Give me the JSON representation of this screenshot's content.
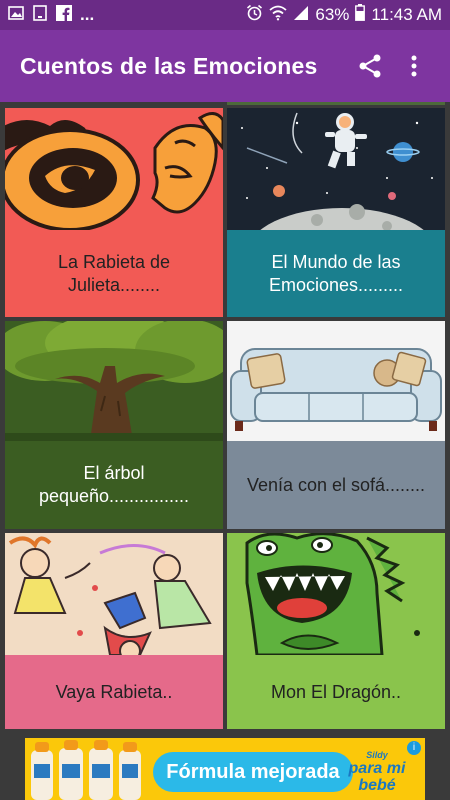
{
  "status_bar": {
    "left_icons": [
      "image-icon",
      "tablet-icon",
      "facebook-icon",
      "more-icon"
    ],
    "more_label": "...",
    "battery": "63%",
    "time": "11:43 AM"
  },
  "app_bar": {
    "title": "Cuentos de las Emociones",
    "share_icon": "share-icon",
    "menu_icon": "overflow-menu-icon"
  },
  "stories": [
    {
      "title": "La Rabieta de Julieta........",
      "image": "angry-faces",
      "caption_bg": "#f25a55"
    },
    {
      "title": "El Mundo de las Emociones.........",
      "image": "astronaut-space",
      "caption_bg": "#1a7f8e"
    },
    {
      "title": "El árbol pequeño................",
      "image": "tree",
      "caption_bg": "#3b5d22"
    },
    {
      "title": "Venía con el sofá........",
      "image": "sofa",
      "caption_bg": "#7c8a99"
    },
    {
      "title": "Vaya Rabieta..",
      "image": "kids-jumping",
      "caption_bg": "#e56a8a"
    },
    {
      "title": "Mon El Dragón..",
      "image": "green-monster",
      "caption_bg": "#8ac44c"
    }
  ],
  "ad": {
    "text": "Fórmula mejorada",
    "brand_small": "Sildy",
    "brand": "para mi bebé",
    "info": "i"
  }
}
